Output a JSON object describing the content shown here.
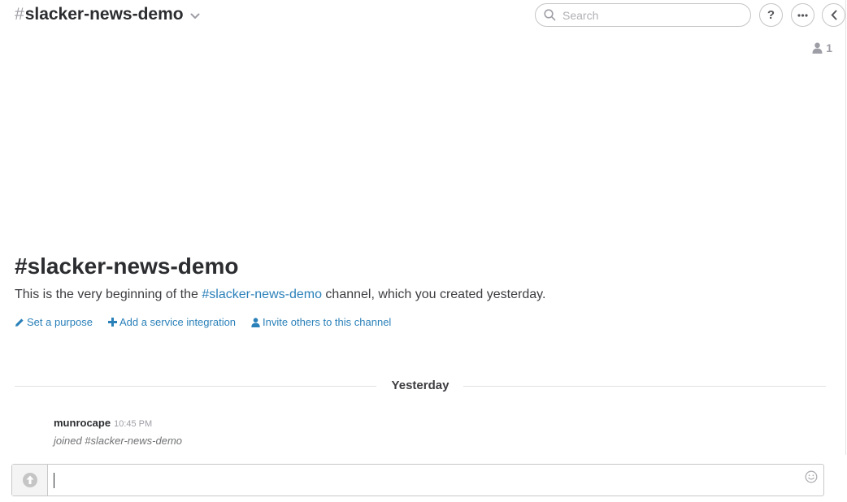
{
  "header": {
    "hash": "#",
    "channel_name": "slacker-news-demo",
    "search_placeholder": "Search",
    "help_label": "?",
    "member_count": "1"
  },
  "intro": {
    "title": "#slacker-news-demo",
    "text_before": "This is the very beginning of the ",
    "channel_link": "#slacker-news-demo",
    "text_after": " channel, which you created yesterday.",
    "actions": {
      "set_purpose": "Set a purpose",
      "add_integration": "Add a service integration",
      "invite_others": "Invite others to this channel"
    }
  },
  "day_divider": {
    "label": "Yesterday"
  },
  "messages": [
    {
      "author": "munrocape",
      "time": "10:45 PM",
      "body": "joined #slacker-news-demo"
    }
  ],
  "composer": {
    "value": ""
  },
  "icons": {
    "search": "search-icon",
    "help": "help-icon",
    "more": "more-icon",
    "collapse": "chevron-left-icon",
    "members": "user-icon",
    "pencil": "pencil-icon",
    "plus": "plus-icon",
    "invite": "user-icon",
    "upload": "upload-icon",
    "emoji": "emoji-icon"
  },
  "colors": {
    "link": "#2a80b9",
    "muted": "#9e9ea6",
    "text": "#2c2d30"
  }
}
